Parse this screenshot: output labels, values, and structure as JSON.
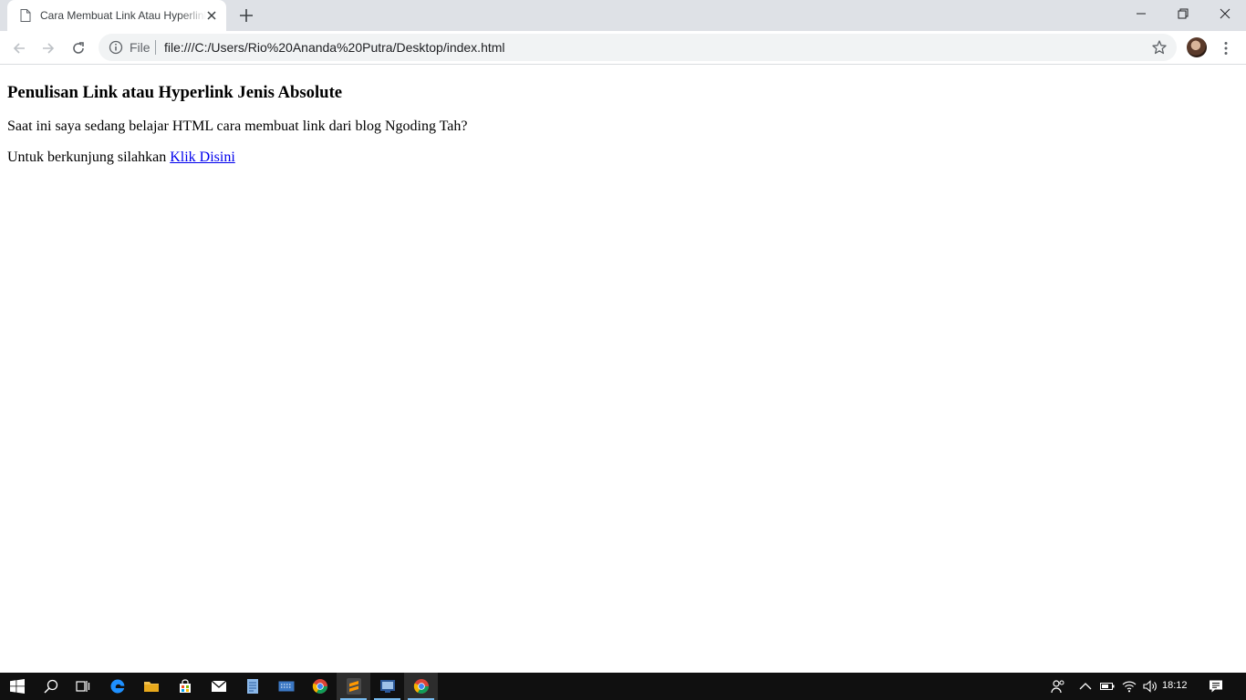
{
  "browser": {
    "tab": {
      "title": "Cara Membuat Link Atau Hyperlink Jenis Absolute"
    },
    "omnibox": {
      "scheme_label": "File",
      "url": "file:///C:/Users/Rio%20Ananda%20Putra/Desktop/index.html"
    }
  },
  "page": {
    "heading": "Penulisan Link atau Hyperlink Jenis Absolute",
    "paragraph1": "Saat ini saya sedang belajar HTML cara membuat link dari blog Ngoding Tah?",
    "paragraph2_prefix": "Untuk berkunjung silahkan ",
    "link_text": "Klik Disini"
  },
  "taskbar": {
    "clock": "18:12",
    "apps": [
      "start-icon",
      "search-icon",
      "task-view-icon",
      "edge-icon",
      "file-explorer-icon",
      "store-icon",
      "mail-icon",
      "notes-icon",
      "keyboard-icon",
      "chrome-icon",
      "sublime-text-icon",
      "app-icon",
      "chrome-icon"
    ]
  },
  "colors": {
    "tabstrip_bg": "#dee1e6",
    "omnibox_bg": "#f1f3f4",
    "link": "#0000ee",
    "taskbar_bg": "#101010",
    "taskbar_accent": "#76b9ed"
  }
}
